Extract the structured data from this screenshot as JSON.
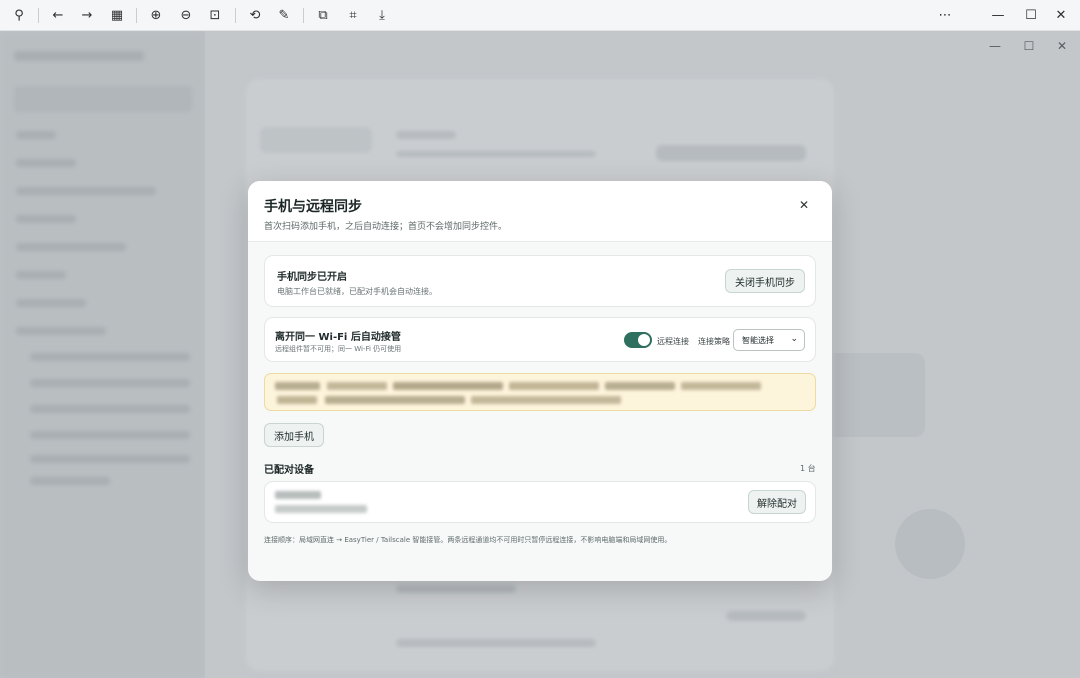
{
  "viewer_toolbar": {
    "icons": [
      "pin-icon",
      "back-arrow-icon",
      "forward-arrow-icon",
      "grid-icon",
      "zoom-in-icon",
      "zoom-out-icon",
      "fit-icon",
      "rotate-icon",
      "edit-icon",
      "copy-icon",
      "crop-icon",
      "save-icon",
      "more-icon",
      "minimize-icon",
      "maximize-icon",
      "close-icon"
    ],
    "glyphs": {
      "pin": "⚲",
      "back": "←",
      "forward": "→",
      "grid": "▦",
      "zoom_in": "⊕",
      "zoom_out": "⊖",
      "fit": "⊡",
      "rotate": "⟲",
      "edit": "✎",
      "copy": "⧉",
      "crop": "⌗",
      "save": "⤓",
      "more": "⋯",
      "minimize": "—",
      "maximize": "☐",
      "close": "✕"
    }
  },
  "dialog": {
    "title": "手机与远程同步",
    "subtitle": "首次扫码添加手机，之后自动连接；首页不会增加同步控件。",
    "close_glyph": "✕",
    "sync_card": {
      "title": "手机同步已开启",
      "desc": "电脑工作台已就绪，已配对手机会自动连接。",
      "button": "关闭手机同步"
    },
    "wifi_card": {
      "title": "离开同一 Wi-Fi 后自动接管",
      "desc": "远程组件暂不可用；同一 Wi-Fi 仍可使用",
      "toggle_label": "远程连接",
      "toggle_on": true,
      "strategy_label": "连接策略",
      "strategy_value": "智能选择",
      "chevron": "⌄"
    },
    "add_button": "添加手机",
    "paired_title": "已配对设备",
    "paired_count": "1 台",
    "unpair_button": "解除配对",
    "footer": "连接顺序：局域网直连 → EasyTier / Tailscale 智能接管。两条远程通道均不可用时只暂停远程连接，不影响电脑端和局域网使用。"
  },
  "colors": {
    "accent": "#2f6f5f",
    "notice_bg": "#fdf4dc",
    "notice_border": "#efd9a4"
  }
}
